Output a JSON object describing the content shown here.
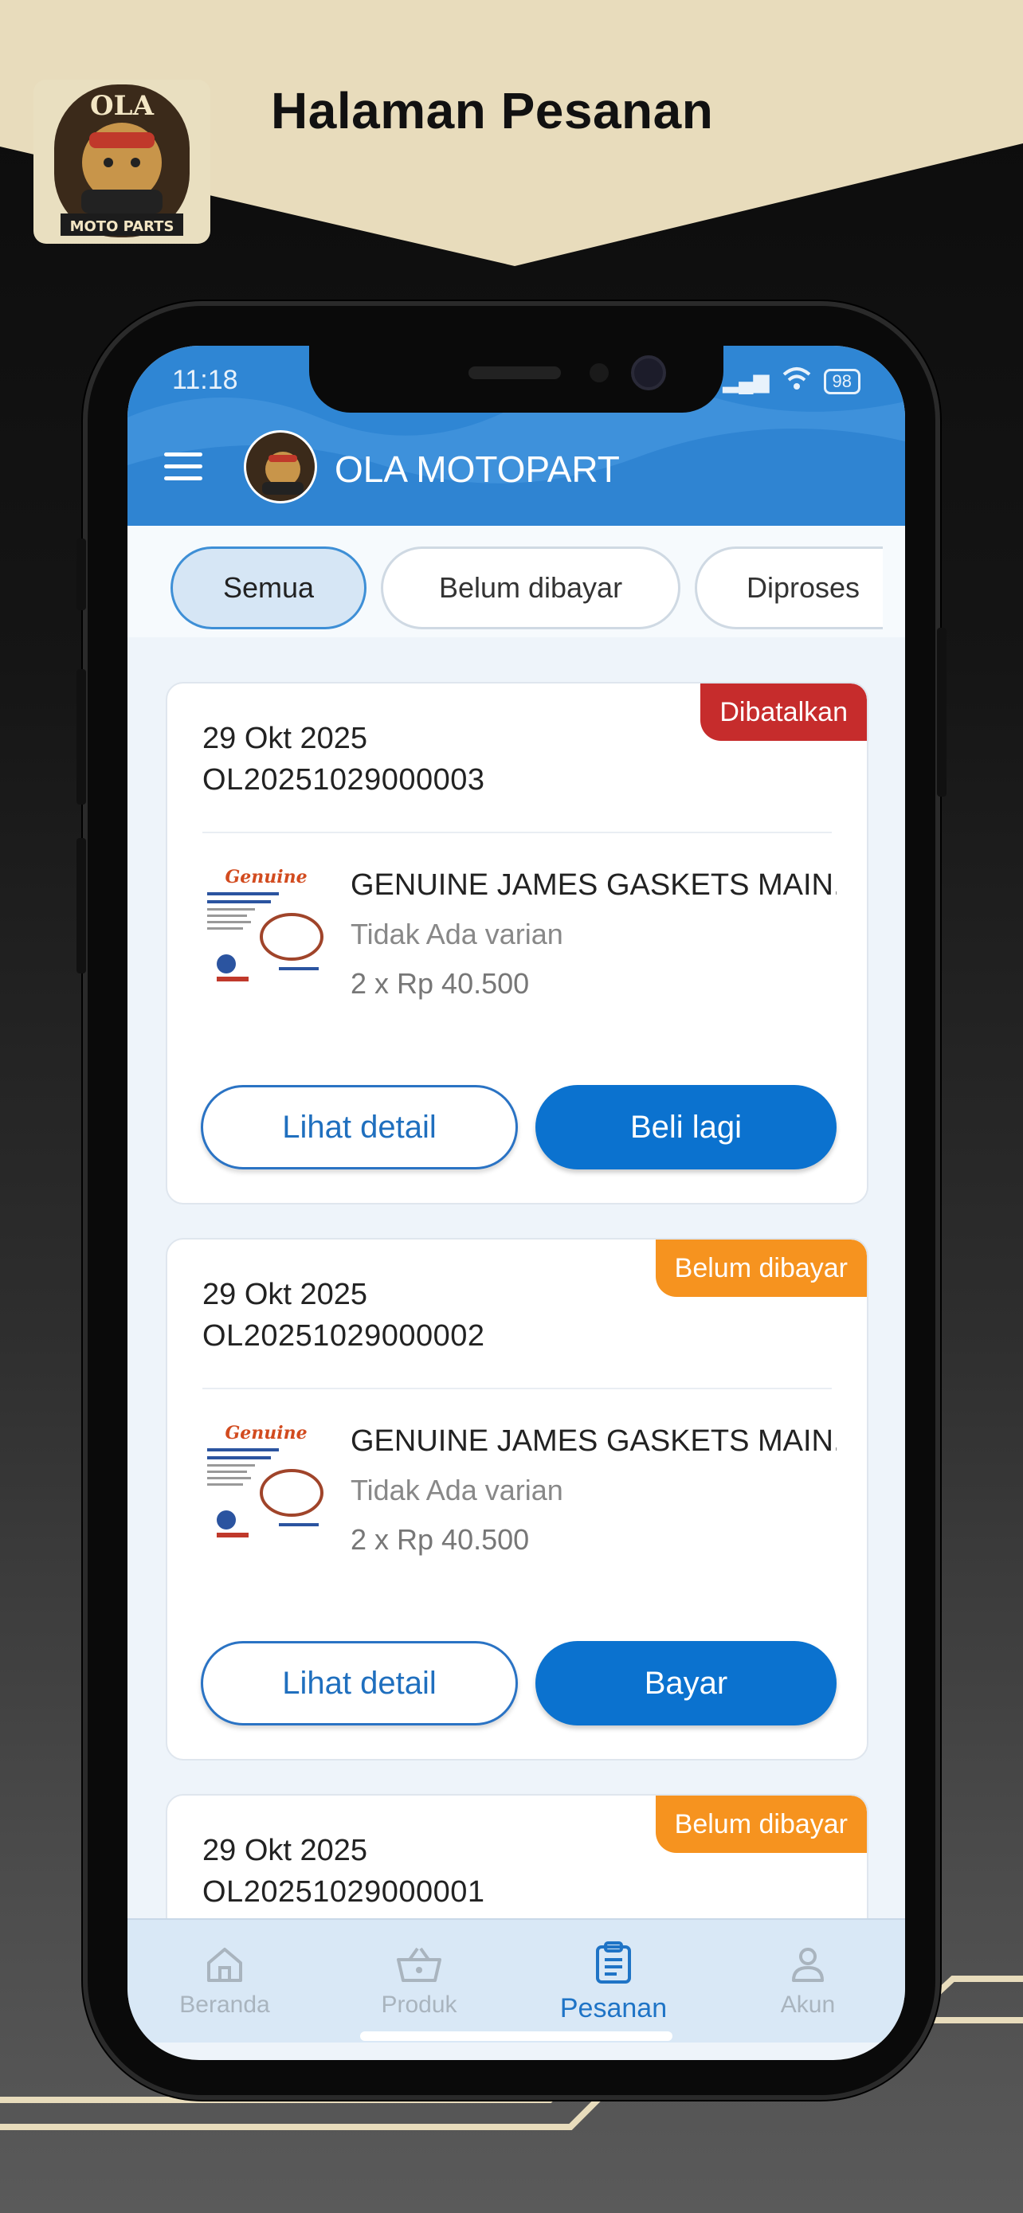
{
  "banner": {
    "title": "Halaman Pesanan",
    "logo_text_top": "OLA",
    "logo_text_bottom": "MOTO PARTS"
  },
  "status_bar": {
    "time": "11:18",
    "battery": "98"
  },
  "app_bar": {
    "title": "OLA MOTOPART"
  },
  "filter_tabs": [
    {
      "label": "Semua",
      "active": true
    },
    {
      "label": "Belum dibayar",
      "active": false
    },
    {
      "label": "Diproses",
      "active": false
    }
  ],
  "orders": [
    {
      "date": "29 Okt 2025",
      "order_id": "OL20251029000003",
      "status": "Dibatalkan",
      "status_color": "#c62c2c",
      "product_name": "GENUINE JAMES GASKETS MAIN...",
      "variant": "Tidak Ada varian",
      "price_line": "2 x Rp 40.500",
      "primary_button": "Lihat detail",
      "action_button": "Beli lagi"
    },
    {
      "date": "29 Okt 2025",
      "order_id": "OL20251029000002",
      "status": "Belum dibayar",
      "status_color": "#f6931f",
      "product_name": "GENUINE JAMES GASKETS MAIN...",
      "variant": "Tidak Ada varian",
      "price_line": "2 x Rp 40.500",
      "primary_button": "Lihat detail",
      "action_button": "Bayar"
    },
    {
      "date": "29 Okt 2025",
      "order_id": "OL20251029000001",
      "status": "Belum dibayar",
      "status_color": "#f6931f"
    }
  ],
  "bottom_nav": [
    {
      "label": "Beranda",
      "icon": "home-icon",
      "active": false
    },
    {
      "label": "Produk",
      "icon": "basket-icon",
      "active": false
    },
    {
      "label": "Pesanan",
      "icon": "clipboard-icon",
      "active": true
    },
    {
      "label": "Akun",
      "icon": "user-icon",
      "active": false
    }
  ],
  "colors": {
    "banner": "#e8dcbc",
    "app_bar": "#2f86d4",
    "primary": "#0b72cf",
    "cancelled": "#c62c2c",
    "unpaid": "#f6931f"
  }
}
